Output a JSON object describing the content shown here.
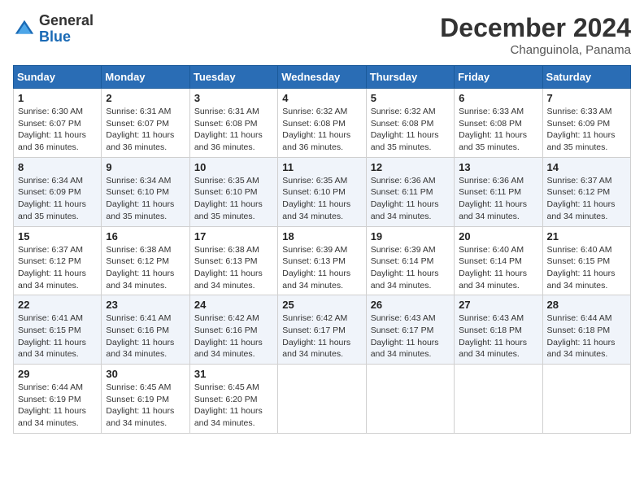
{
  "header": {
    "logo_general": "General",
    "logo_blue": "Blue",
    "month_title": "December 2024",
    "location": "Changuinola, Panama"
  },
  "days_of_week": [
    "Sunday",
    "Monday",
    "Tuesday",
    "Wednesday",
    "Thursday",
    "Friday",
    "Saturday"
  ],
  "weeks": [
    [
      {
        "day": 1,
        "sunrise": "6:30 AM",
        "sunset": "6:07 PM",
        "daylight": "11 hours and 36 minutes."
      },
      {
        "day": 2,
        "sunrise": "6:31 AM",
        "sunset": "6:07 PM",
        "daylight": "11 hours and 36 minutes."
      },
      {
        "day": 3,
        "sunrise": "6:31 AM",
        "sunset": "6:08 PM",
        "daylight": "11 hours and 36 minutes."
      },
      {
        "day": 4,
        "sunrise": "6:32 AM",
        "sunset": "6:08 PM",
        "daylight": "11 hours and 36 minutes."
      },
      {
        "day": 5,
        "sunrise": "6:32 AM",
        "sunset": "6:08 PM",
        "daylight": "11 hours and 35 minutes."
      },
      {
        "day": 6,
        "sunrise": "6:33 AM",
        "sunset": "6:08 PM",
        "daylight": "11 hours and 35 minutes."
      },
      {
        "day": 7,
        "sunrise": "6:33 AM",
        "sunset": "6:09 PM",
        "daylight": "11 hours and 35 minutes."
      }
    ],
    [
      {
        "day": 8,
        "sunrise": "6:34 AM",
        "sunset": "6:09 PM",
        "daylight": "11 hours and 35 minutes."
      },
      {
        "day": 9,
        "sunrise": "6:34 AM",
        "sunset": "6:10 PM",
        "daylight": "11 hours and 35 minutes."
      },
      {
        "day": 10,
        "sunrise": "6:35 AM",
        "sunset": "6:10 PM",
        "daylight": "11 hours and 35 minutes."
      },
      {
        "day": 11,
        "sunrise": "6:35 AM",
        "sunset": "6:10 PM",
        "daylight": "11 hours and 34 minutes."
      },
      {
        "day": 12,
        "sunrise": "6:36 AM",
        "sunset": "6:11 PM",
        "daylight": "11 hours and 34 minutes."
      },
      {
        "day": 13,
        "sunrise": "6:36 AM",
        "sunset": "6:11 PM",
        "daylight": "11 hours and 34 minutes."
      },
      {
        "day": 14,
        "sunrise": "6:37 AM",
        "sunset": "6:12 PM",
        "daylight": "11 hours and 34 minutes."
      }
    ],
    [
      {
        "day": 15,
        "sunrise": "6:37 AM",
        "sunset": "6:12 PM",
        "daylight": "11 hours and 34 minutes."
      },
      {
        "day": 16,
        "sunrise": "6:38 AM",
        "sunset": "6:12 PM",
        "daylight": "11 hours and 34 minutes."
      },
      {
        "day": 17,
        "sunrise": "6:38 AM",
        "sunset": "6:13 PM",
        "daylight": "11 hours and 34 minutes."
      },
      {
        "day": 18,
        "sunrise": "6:39 AM",
        "sunset": "6:13 PM",
        "daylight": "11 hours and 34 minutes."
      },
      {
        "day": 19,
        "sunrise": "6:39 AM",
        "sunset": "6:14 PM",
        "daylight": "11 hours and 34 minutes."
      },
      {
        "day": 20,
        "sunrise": "6:40 AM",
        "sunset": "6:14 PM",
        "daylight": "11 hours and 34 minutes."
      },
      {
        "day": 21,
        "sunrise": "6:40 AM",
        "sunset": "6:15 PM",
        "daylight": "11 hours and 34 minutes."
      }
    ],
    [
      {
        "day": 22,
        "sunrise": "6:41 AM",
        "sunset": "6:15 PM",
        "daylight": "11 hours and 34 minutes."
      },
      {
        "day": 23,
        "sunrise": "6:41 AM",
        "sunset": "6:16 PM",
        "daylight": "11 hours and 34 minutes."
      },
      {
        "day": 24,
        "sunrise": "6:42 AM",
        "sunset": "6:16 PM",
        "daylight": "11 hours and 34 minutes."
      },
      {
        "day": 25,
        "sunrise": "6:42 AM",
        "sunset": "6:17 PM",
        "daylight": "11 hours and 34 minutes."
      },
      {
        "day": 26,
        "sunrise": "6:43 AM",
        "sunset": "6:17 PM",
        "daylight": "11 hours and 34 minutes."
      },
      {
        "day": 27,
        "sunrise": "6:43 AM",
        "sunset": "6:18 PM",
        "daylight": "11 hours and 34 minutes."
      },
      {
        "day": 28,
        "sunrise": "6:44 AM",
        "sunset": "6:18 PM",
        "daylight": "11 hours and 34 minutes."
      }
    ],
    [
      {
        "day": 29,
        "sunrise": "6:44 AM",
        "sunset": "6:19 PM",
        "daylight": "11 hours and 34 minutes."
      },
      {
        "day": 30,
        "sunrise": "6:45 AM",
        "sunset": "6:19 PM",
        "daylight": "11 hours and 34 minutes."
      },
      {
        "day": 31,
        "sunrise": "6:45 AM",
        "sunset": "6:20 PM",
        "daylight": "11 hours and 34 minutes."
      },
      null,
      null,
      null,
      null
    ]
  ]
}
